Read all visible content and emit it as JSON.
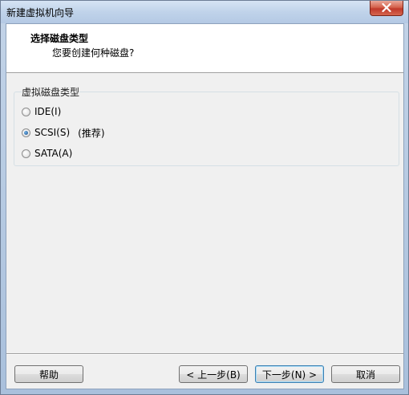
{
  "window": {
    "title": "新建虚拟机向导"
  },
  "header": {
    "title": "选择磁盘类型",
    "subtitle": "您要创建何种磁盘?"
  },
  "disk_type_group": {
    "label": "虚拟磁盘类型",
    "options": [
      {
        "label": "IDE(I)",
        "checked": false
      },
      {
        "label": "SCSI(S)",
        "note": "(推荐)",
        "checked": true
      },
      {
        "label": "SATA(A)",
        "checked": false
      }
    ]
  },
  "buttons": {
    "help": "帮助",
    "back": "< 上一步(B)",
    "next": "下一步(N) >",
    "cancel": "取消"
  },
  "icons": {
    "close": "close-icon"
  }
}
